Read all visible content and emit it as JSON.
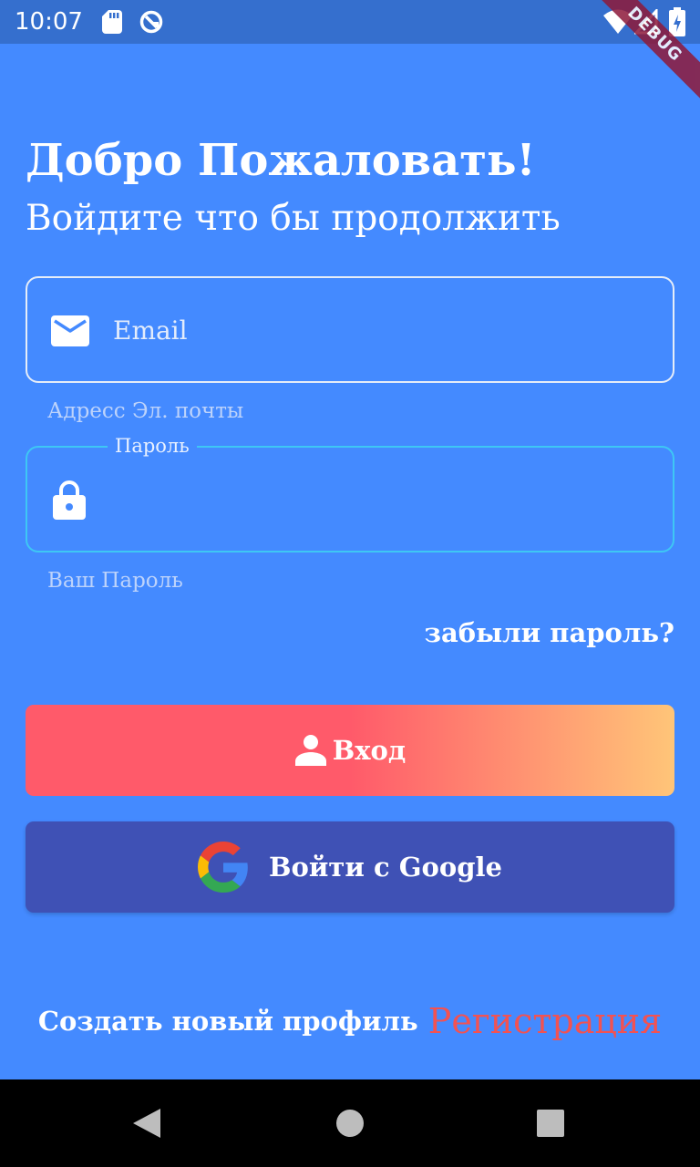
{
  "status_bar": {
    "time": "10:07",
    "icons": [
      "sd-card-icon",
      "sync-icon",
      "wifi-icon",
      "signal-icon",
      "battery-icon"
    ]
  },
  "debug_banner": "DEBUG",
  "header": {
    "title": "Добро Пожаловать!",
    "subtitle": "Войдите что бы продолжить"
  },
  "email_field": {
    "icon": "mail-icon",
    "placeholder": "Email",
    "value": "",
    "helper": "Адресс Эл. почты"
  },
  "password_field": {
    "icon": "lock-icon",
    "label": "Пароль",
    "value": "",
    "helper": "Ваш Пароль"
  },
  "forgot_password": "забыли пароль?",
  "login_button": {
    "label": "Вход",
    "icon": "person-icon"
  },
  "google_button": {
    "label": "Войти с Google",
    "icon": "google-icon"
  },
  "register": {
    "prompt": "Создать новый профиль",
    "link": "Регистрация"
  },
  "navigation": [
    "back",
    "home",
    "recents"
  ],
  "colors": {
    "background": "#448aff",
    "status_bar": "#356fce",
    "login_gradient_start": "#ff5a6a",
    "login_gradient_end": "#ffc578",
    "google_button": "#3f51b5",
    "register_link": "#f25252",
    "password_border": "#3ec7f4"
  }
}
